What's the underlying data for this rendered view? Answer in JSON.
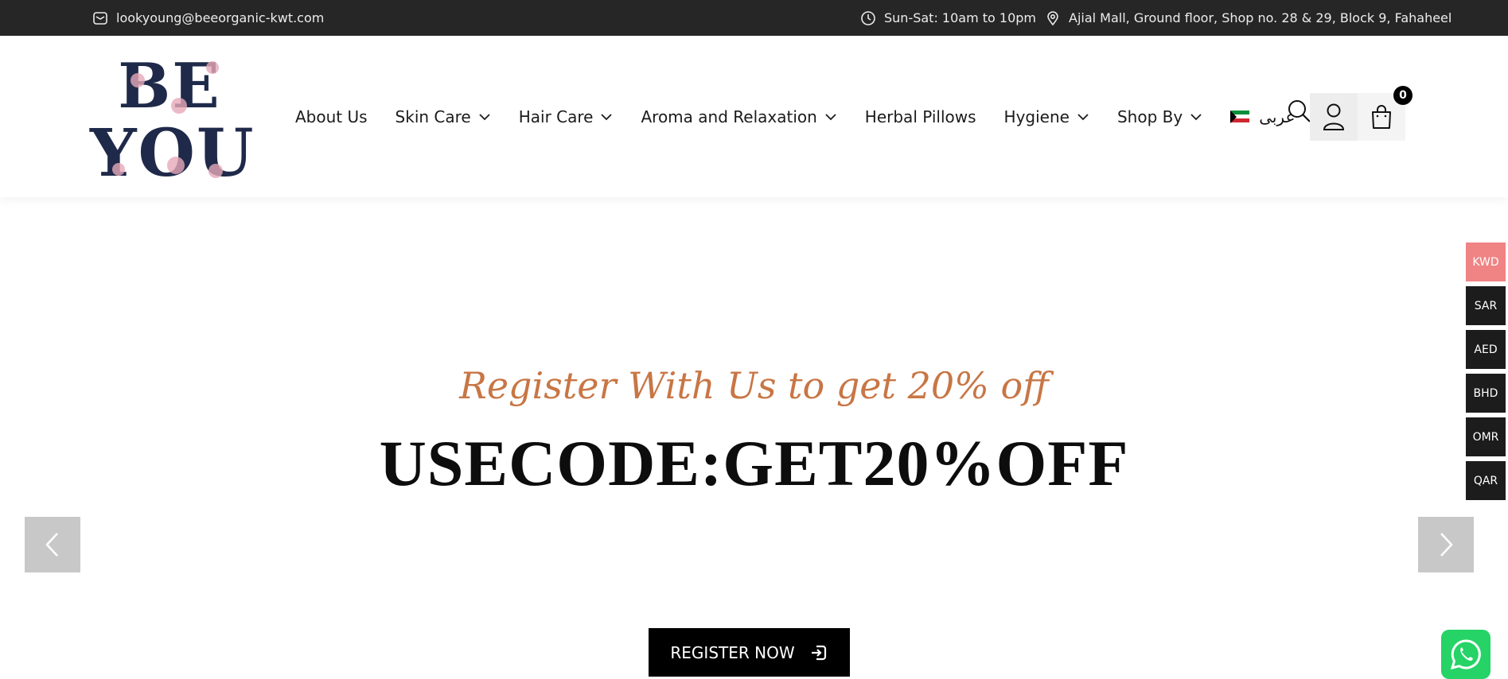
{
  "topbar": {
    "email": "lookyoung@beeorganic-kwt.com",
    "hours": "Sun-Sat: 10am to 10pm",
    "address": "Ajial Mall, Ground floor, Shop no. 28 & 29, Block 9, Fahaheel",
    "icons": {
      "email": "envelope-icon",
      "hours": "clock-icon",
      "address": "map-pin-icon"
    }
  },
  "logo": {
    "line1": "BE",
    "line2": "YOU"
  },
  "nav": {
    "items": [
      {
        "label": "About Us",
        "dropdown": false
      },
      {
        "label": "Skin Care",
        "dropdown": true
      },
      {
        "label": "Hair Care",
        "dropdown": true
      },
      {
        "label": "Aroma and Relaxation",
        "dropdown": true
      },
      {
        "label": "Herbal Pillows",
        "dropdown": false
      },
      {
        "label": "Hygiene",
        "dropdown": true
      },
      {
        "label": "Shop By",
        "dropdown": true
      }
    ],
    "language": "عربى"
  },
  "header_icons": {
    "search": "search-icon",
    "account": "user-icon",
    "cart": "shopping-bag-icon"
  },
  "cart": {
    "count": "0"
  },
  "hero": {
    "subtitle": "Register With Us to get 20% off",
    "title": "USECODE:GET20%OFF",
    "button_label": "REGISTER NOW"
  },
  "currencies": [
    "KWD",
    "SAR",
    "AED",
    "BHD",
    "OMR",
    "QAR"
  ],
  "active_currency": "KWD",
  "colors": {
    "topbar": "#262626",
    "accent": "#c87645",
    "active_currency": "#f08383",
    "whatsapp": "#25d366"
  }
}
